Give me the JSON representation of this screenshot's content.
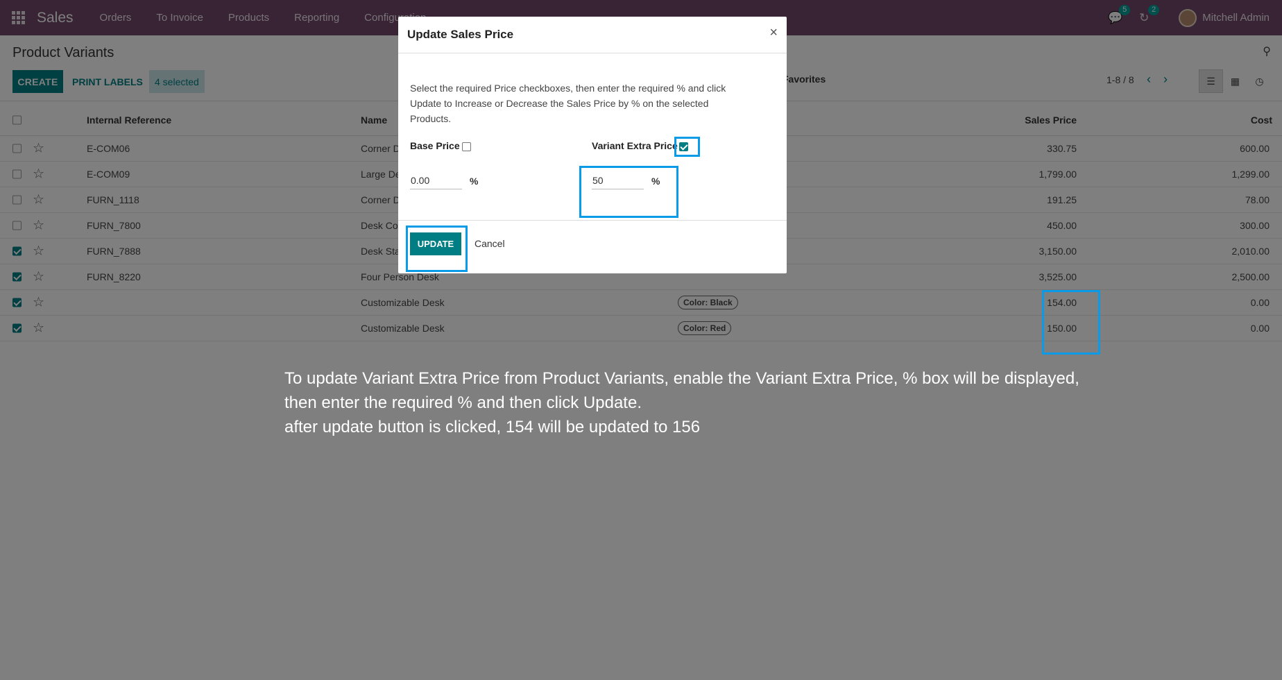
{
  "navbar": {
    "brand": "Sales",
    "menu": [
      "Orders",
      "To Invoice",
      "Products",
      "Reporting",
      "Configuration"
    ],
    "messages_count": "5",
    "activities_count": "2",
    "user_name": "Mitchell Admin"
  },
  "control_panel": {
    "title": "Product Variants",
    "create_label": "CREATE",
    "print_labels_label": "PRINT LABELS",
    "selected_label": "4 selected",
    "favorites_label": "Favorites",
    "pager": "1-8 / 8"
  },
  "table": {
    "headers": {
      "internal_reference": "Internal Reference",
      "name": "Name",
      "sales_price": "Sales Price",
      "cost": "Cost"
    },
    "rows": [
      {
        "checked": false,
        "ref": "E-COM06",
        "name": "Corner Desk Right Sit",
        "tag": "",
        "price": "330.75",
        "cost": "600.00"
      },
      {
        "checked": false,
        "ref": "E-COM09",
        "name": "Large Desk",
        "tag": "",
        "price": "1,799.00",
        "cost": "1,299.00"
      },
      {
        "checked": false,
        "ref": "FURN_1118",
        "name": "Corner Desk Left Sit",
        "tag": "",
        "price": "191.25",
        "cost": "78.00"
      },
      {
        "checked": false,
        "ref": "FURN_7800",
        "name": "Desk Combination",
        "tag": "",
        "price": "450.00",
        "cost": "300.00"
      },
      {
        "checked": true,
        "ref": "FURN_7888",
        "name": "Desk Stand with Screen",
        "tag": "",
        "price": "3,150.00",
        "cost": "2,010.00"
      },
      {
        "checked": true,
        "ref": "FURN_8220",
        "name": "Four Person Desk",
        "tag": "",
        "price": "3,525.00",
        "cost": "2,500.00"
      },
      {
        "checked": true,
        "ref": "",
        "name": "Customizable Desk",
        "tag": "Color: Black",
        "price": "154.00",
        "cost": "0.00"
      },
      {
        "checked": true,
        "ref": "",
        "name": "Customizable Desk",
        "tag": "Color: Red",
        "price": "150.00",
        "cost": "0.00"
      }
    ]
  },
  "modal": {
    "title": "Update Sales Price",
    "close": "×",
    "description": "Select the required Price checkboxes, then enter the required % and click Update to Increase or Decrease the Sales Price by % on the selected Products.",
    "base_price_label": "Base Price",
    "base_price_checked": false,
    "base_price_value": "0.00",
    "variant_extra_label": "Variant Extra Price",
    "variant_extra_checked": true,
    "variant_extra_value": "50",
    "percent": "%",
    "update_label": "UPDATE",
    "cancel_label": "Cancel"
  },
  "annotation": {
    "line1": "To update Variant Extra Price from Product Variants, enable the Variant Extra Price, % box will be displayed,",
    "line2": "then enter the required % and then click Update.",
    "line3": "after update button is clicked, 154 will be updated to 156"
  },
  "colors": {
    "navbar": "#71486a",
    "primary": "#017e84",
    "highlight": "#0a9be8"
  }
}
